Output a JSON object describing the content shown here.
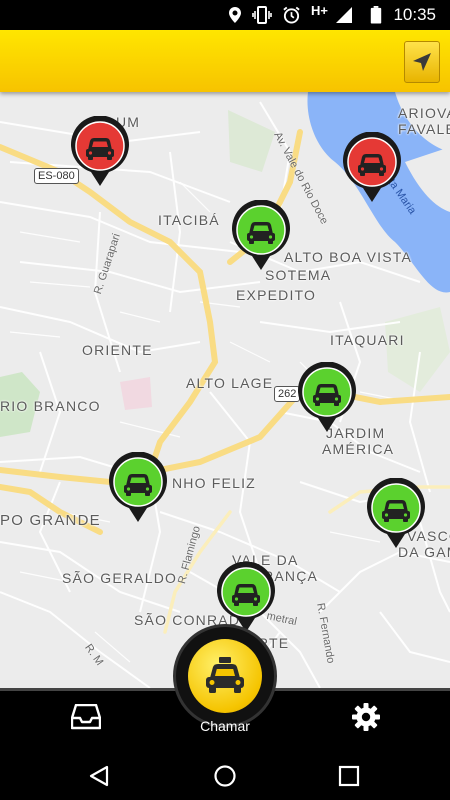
{
  "status_bar": {
    "time": "10:35",
    "network": "H+"
  },
  "app_bar": {
    "locate_icon": "navigation-arrow-icon"
  },
  "map": {
    "neighborhoods": [
      {
        "key": "aeroporto",
        "label": "UM"
      },
      {
        "key": "itaciba",
        "label": "ITACIBÁ"
      },
      {
        "key": "alto_boa_vista",
        "label": "ALTO BOA VISTA"
      },
      {
        "key": "sotema",
        "label": "SOTEMA"
      },
      {
        "key": "expedito",
        "label": "EXPEDITO"
      },
      {
        "key": "oriente",
        "label": "ORIENTE"
      },
      {
        "key": "itaquari",
        "label": "ITAQUARI"
      },
      {
        "key": "alto_lage",
        "label": "ALTO LAGE"
      },
      {
        "key": "rio_branco",
        "label": "RIO BRANCO"
      },
      {
        "key": "jardim_america_1",
        "label": "JARDIM"
      },
      {
        "key": "jardim_america_2",
        "label": "AMÉRICA"
      },
      {
        "key": "campo_grande",
        "label": "PO GRANDE"
      },
      {
        "key": "vale_feliz",
        "label": "NHO FELIZ"
      },
      {
        "key": "vale_da_esperanca_1",
        "label": "VALE DA"
      },
      {
        "key": "vale_da_esperanca_2",
        "label": "PERANÇA"
      },
      {
        "key": "sao_geraldo",
        "label": "SÃO GERALDO"
      },
      {
        "key": "sao_conrado",
        "label": "SÃO CONRADO"
      },
      {
        "key": "norte",
        "label": "RTE"
      },
      {
        "key": "vasco_1",
        "label": "VASCO"
      },
      {
        "key": "vasco_2",
        "label": "DA GAM"
      },
      {
        "key": "ariovaldo_1",
        "label": "ARIOVA"
      },
      {
        "key": "ariovaldo_2",
        "label": "FAVALE"
      }
    ],
    "streets": [
      {
        "key": "guarapari",
        "label": "R. Guarapari"
      },
      {
        "key": "vale_rio_doce",
        "label": "Av. Vale do Rio Doce"
      },
      {
        "key": "flamingo",
        "label": "R. Flamingo"
      },
      {
        "key": "fernando",
        "label": "R. Fernando"
      },
      {
        "key": "rm",
        "label": "R. M"
      },
      {
        "key": "metral",
        "label": "metral"
      }
    ],
    "water_label": "nta Maria",
    "shields": [
      {
        "key": "es080",
        "label": "ES-080"
      },
      {
        "key": "r262",
        "label": "262"
      }
    ],
    "taxis": [
      {
        "key": "taxi-1",
        "status": "busy",
        "color": "#e53935"
      },
      {
        "key": "taxi-2",
        "status": "busy",
        "color": "#e53935"
      },
      {
        "key": "taxi-3",
        "status": "available",
        "color": "#5bd12e"
      },
      {
        "key": "taxi-4",
        "status": "available",
        "color": "#5bd12e"
      },
      {
        "key": "taxi-5",
        "status": "available",
        "color": "#5bd12e"
      },
      {
        "key": "taxi-6",
        "status": "available",
        "color": "#5bd12e"
      },
      {
        "key": "taxi-7",
        "status": "available",
        "color": "#5bd12e"
      }
    ]
  },
  "bottom_bar": {
    "call_label": "Chamar",
    "inbox_icon": "inbox-icon",
    "settings_icon": "gear-icon",
    "call_icon": "taxi-icon"
  },
  "colors": {
    "brand_yellow": "#f7c300",
    "busy_red": "#e53935",
    "available_green": "#5bd12e"
  }
}
